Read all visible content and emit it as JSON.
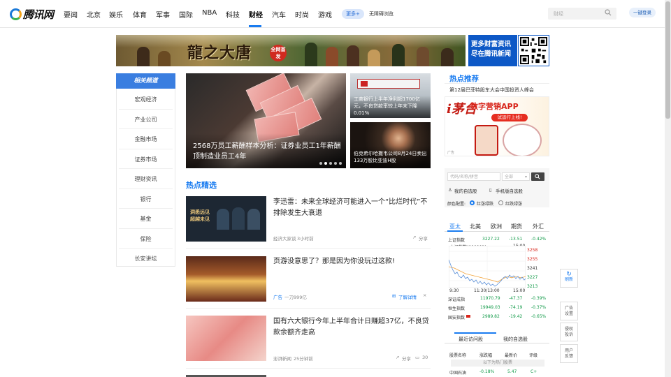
{
  "logo": {
    "text": "腾讯网"
  },
  "nav": {
    "items": [
      "要闻",
      "北京",
      "娱乐",
      "体育",
      "军事",
      "国际",
      "NBA",
      "科技",
      "财经",
      "汽车",
      "时尚",
      "游戏"
    ],
    "active": "财经",
    "more_label": "更多+",
    "barrier_free": "无障碍浏览"
  },
  "search": {
    "placeholder": "财经"
  },
  "login": {
    "label": "一键登录"
  },
  "banner": {
    "game_title": "龍之大唐",
    "game_badge": "全网首发",
    "blue_text_1": "更多财富资讯",
    "blue_text_2": "尽在腾讯新闻"
  },
  "sidebar": {
    "title": "相关频道",
    "items": [
      "宏观经济",
      "产业公司",
      "金融市场",
      "证券市场",
      "理财资讯",
      "银行",
      "基金",
      "保险",
      "长安讲坛"
    ]
  },
  "focus": {
    "main_caption": "2568万员工薪酬样本分析：证券业员工1年薪酬顶制造业员工4年",
    "r1_caption": "工商银行上半年净利超1700亿元，不良贷款率较上年末下降0.01%",
    "r2_caption": "伯克希尔哈撒韦公司8月24日卖出133万股比亚迪H股"
  },
  "hot": {
    "title": "热点精选",
    "articles": [
      {
        "title": "李迅雷：未来全球经济可能进入一个“比烂时代”不排除发生大衰退",
        "source": "经济大家谈",
        "time": "3小时前",
        "share": "分享",
        "img_text_1": "洞悉远见",
        "img_text_2": "超越未见"
      },
      {
        "title": "页游没意思了？那是因为你没玩过这款!",
        "source": "广告",
        "time": "一刀999亿",
        "action": "了解详情"
      },
      {
        "title": "国有六大银行今年上半年合计日赚超37亿，不良贷款余额齐走高",
        "source": "澎湃新闻",
        "time": "25分钟前",
        "share": "分享",
        "comments": "30"
      }
    ]
  },
  "right": {
    "hot_rec_title": "热点推荐",
    "hot_rec_item": "第12届巴菲特股东大会中国投资人峰会",
    "maotai": {
      "logo": "i茅台",
      "title": "数字营销APP",
      "try": "试运行上线!",
      "ad": "广告"
    },
    "stock": {
      "input_ph": "代码/名称/拼音",
      "select": "全部",
      "my_stocks": "我的自选股",
      "mobile_stocks": "手机版自选股",
      "color_label": "颜色配置:",
      "opt1": "红涨绿跌",
      "opt2": "红跌绿涨"
    },
    "market": {
      "tabs": [
        "亚太",
        "北美",
        "欧洲",
        "期货",
        "外汇"
      ],
      "active": "亚太",
      "top_row": {
        "name": "上证指数",
        "value": "3227.22",
        "change": "-13.51",
        "pct": "-0.42%"
      },
      "chart_label": "上证指数(000001)",
      "chart_time": "15:00",
      "chart_ticks": [
        "3258",
        "3255",
        "3241",
        "3227",
        "3213"
      ],
      "x_ticks": [
        "9:30",
        "11:30/13:00",
        "15:00"
      ],
      "rows": [
        {
          "name": "深证成指",
          "value": "11970.79",
          "change": "-47.37",
          "pct": "-0.39%"
        },
        {
          "name": "恒生指数",
          "value": "19949.03",
          "change": "-74.19",
          "pct": "-0.37%"
        },
        {
          "name": "国安指数",
          "value": "2989.82",
          "change": "-19.42",
          "pct": "-0.65%"
        }
      ]
    },
    "recent": {
      "tabs": [
        "最近访问股",
        "我的自选股"
      ],
      "headers": [
        "股票名称",
        "涨跌幅",
        "最新价",
        "评级"
      ],
      "note": "以下为热门股票",
      "row": {
        "name": "中国石油",
        "pct": "-0.18%",
        "price": "5.47",
        "rating": "C+"
      }
    }
  },
  "float": {
    "refresh": "刷新",
    "ad_setting_1": "广告",
    "ad_setting_2": "设置",
    "report_1": "侵权",
    "report_2": "投诉",
    "feedback_1": "用户",
    "feedback_2": "反馈"
  }
}
